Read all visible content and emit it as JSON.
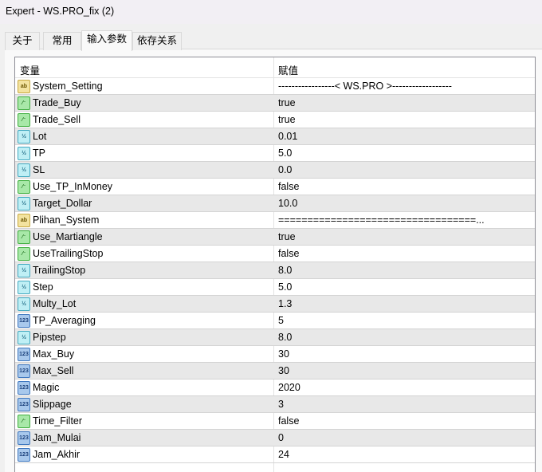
{
  "window": {
    "title": "Expert - WS.PRO_fix (2)"
  },
  "tabs": [
    {
      "label": "关于"
    },
    {
      "label": "常用"
    },
    {
      "label": "输入参数"
    },
    {
      "label": "依存关系"
    }
  ],
  "active_tab": "输入参数",
  "table": {
    "headers": {
      "variable": "变量",
      "value": "赋值"
    },
    "rows": [
      {
        "name": "System_Setting",
        "value": "-----------------< WS.PRO  >------------------",
        "type": "string"
      },
      {
        "name": "Trade_Buy",
        "value": "true",
        "type": "bool"
      },
      {
        "name": "Trade_Sell",
        "value": "true",
        "type": "bool"
      },
      {
        "name": "Lot",
        "value": "0.01",
        "type": "double"
      },
      {
        "name": "TP",
        "value": "5.0",
        "type": "double"
      },
      {
        "name": "SL",
        "value": "0.0",
        "type": "double"
      },
      {
        "name": "Use_TP_InMoney",
        "value": "false",
        "type": "bool"
      },
      {
        "name": "Target_Dollar",
        "value": "10.0",
        "type": "double"
      },
      {
        "name": "Plihan_System",
        "value": "==================================...",
        "type": "string"
      },
      {
        "name": "Use_Martiangle",
        "value": "true",
        "type": "bool"
      },
      {
        "name": "UseTrailingStop",
        "value": "false",
        "type": "bool"
      },
      {
        "name": "TrailingStop",
        "value": "8.0",
        "type": "double"
      },
      {
        "name": "Step",
        "value": "5.0",
        "type": "double"
      },
      {
        "name": "Multy_Lot",
        "value": "1.3",
        "type": "double"
      },
      {
        "name": "TP_Averaging",
        "value": "5",
        "type": "int"
      },
      {
        "name": "Pipstep",
        "value": "8.0",
        "type": "double"
      },
      {
        "name": "Max_Buy",
        "value": "30",
        "type": "int"
      },
      {
        "name": "Max_Sell",
        "value": "30",
        "type": "int"
      },
      {
        "name": "Magic",
        "value": "2020",
        "type": "int"
      },
      {
        "name": "Slippage",
        "value": "3",
        "type": "int"
      },
      {
        "name": "Time_Filter",
        "value": "false",
        "type": "bool"
      },
      {
        "name": "Jam_Mulai",
        "value": "0",
        "type": "int"
      },
      {
        "name": "Jam_Akhir",
        "value": "24",
        "type": "int"
      }
    ]
  },
  "icon_glyphs": {
    "string": "ab",
    "bool": "⁄⁻",
    "double": "½",
    "int": "123"
  }
}
